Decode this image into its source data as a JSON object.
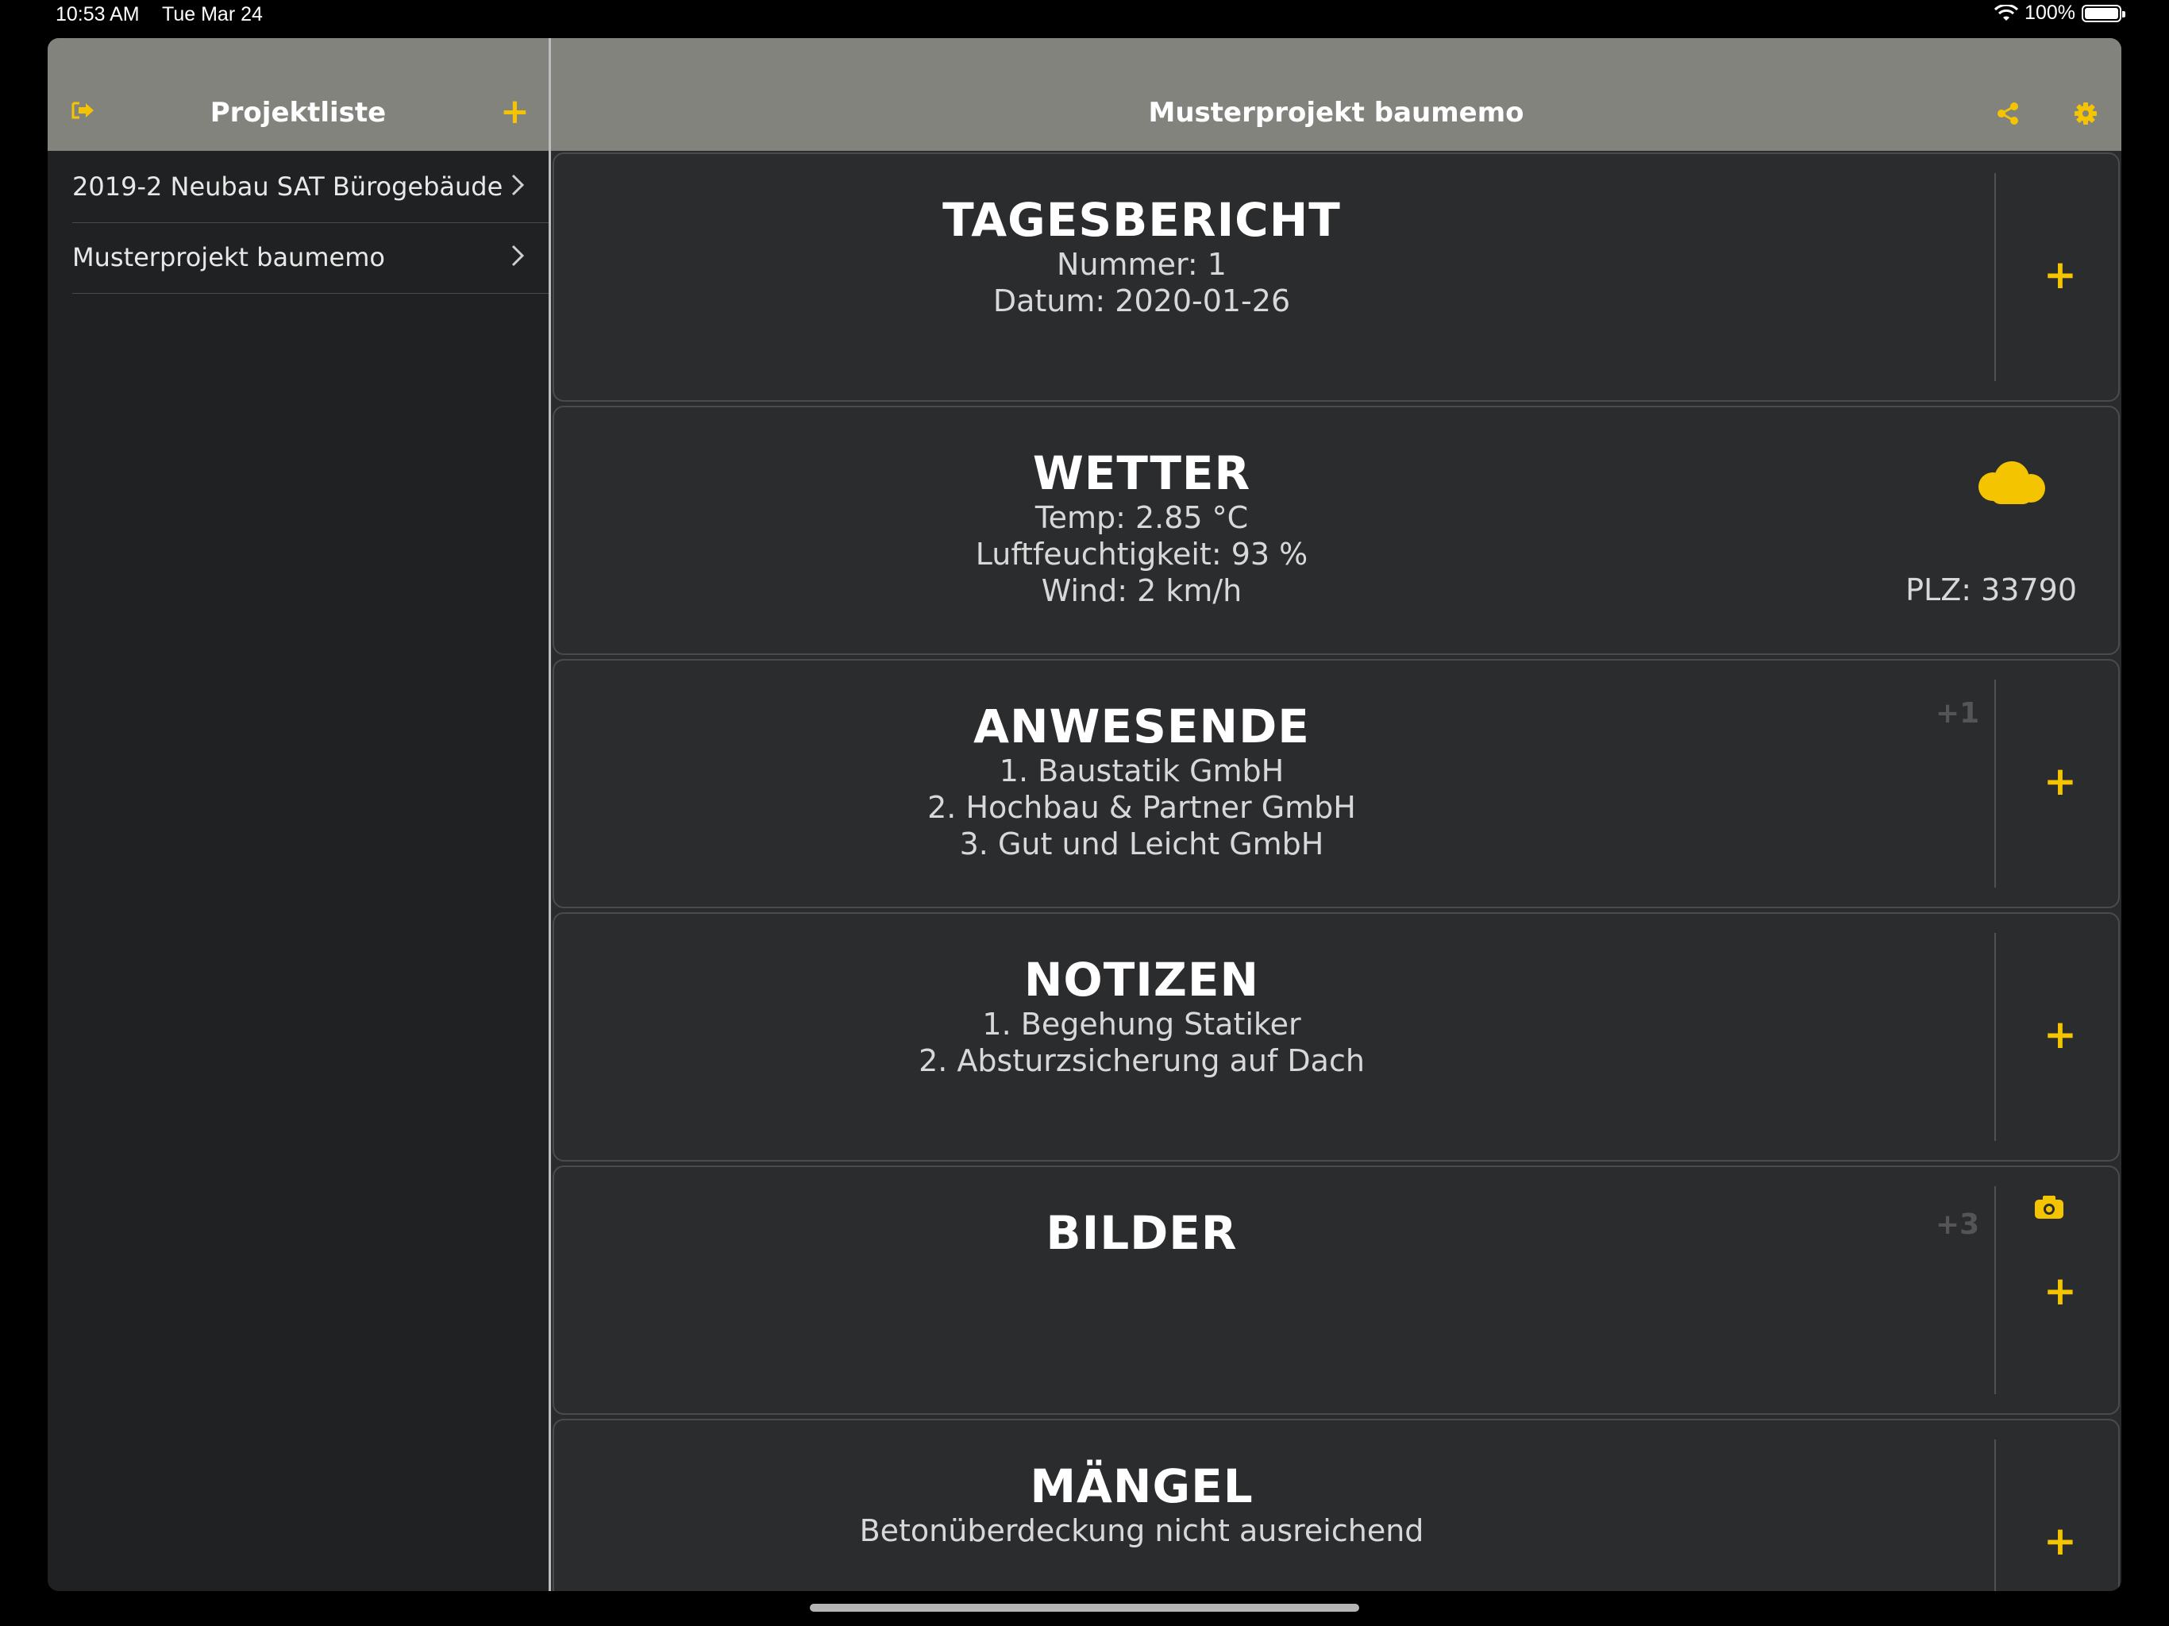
{
  "status_bar": {
    "time": "10:53 AM",
    "date": "Tue Mar 24",
    "battery": "100%",
    "icons": [
      "wifi-icon",
      "battery-icon"
    ]
  },
  "sidebar": {
    "title": "Projektliste",
    "icons": {
      "left": "exit-icon",
      "right": "plus-icon"
    },
    "items": [
      {
        "label": "2019-2 Neubau SAT Bürogebäude"
      },
      {
        "label": "Musterprojekt baumemo"
      }
    ]
  },
  "header": {
    "title": "Musterprojekt baumemo",
    "icons": [
      "share-icon",
      "gear-icon"
    ]
  },
  "accent_color": "#f5c400",
  "cards": {
    "tagesbericht": {
      "title": "TAGESBERICHT",
      "lines": [
        "Nummer: 1",
        "Datum: 2020-01-26"
      ],
      "action": "+"
    },
    "wetter": {
      "title": "WETTER",
      "lines": [
        "Temp:  2.85 °C",
        "Luftfeuchtigkeit:  93 %",
        "Wind:  2 km/h"
      ],
      "plz": "PLZ: 33790",
      "icon": "moon-cloud-icon"
    },
    "anwesende": {
      "title": "ANWESENDE",
      "lines": [
        "1. Baustatik GmbH",
        "2. Hochbau & Partner GmbH",
        "3. Gut und Leicht GmbH"
      ],
      "count": "+1",
      "action": "+"
    },
    "notizen": {
      "title": "NOTIZEN",
      "lines": [
        "1. Begehung Statiker",
        "2. Absturzsicherung auf Dach"
      ],
      "action": "+"
    },
    "bilder": {
      "title": "BILDER",
      "count": "+3",
      "action": "+",
      "icon": "camera-icon"
    },
    "maengel": {
      "title": "MÄNGEL",
      "lines": [
        "Betonüberdeckung nicht ausreichend"
      ],
      "action": "+"
    }
  }
}
